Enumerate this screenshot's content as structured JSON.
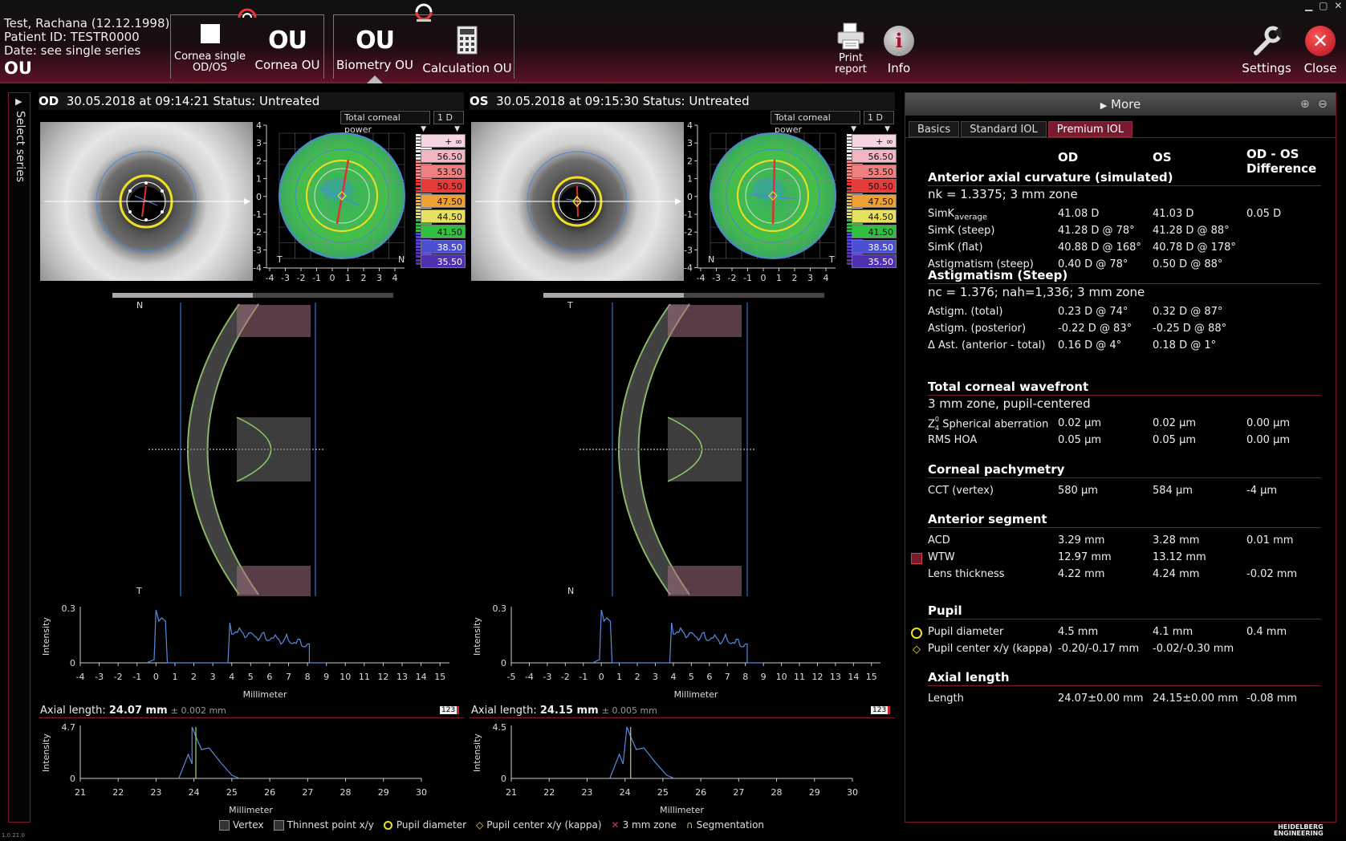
{
  "header": {
    "patient_name": "Test, Rachana (12.12.1998)",
    "patient_id": "Patient ID: TESTR0000",
    "date": "Date: see single series",
    "eye": "OU",
    "buttons": {
      "cornea_single": "Cornea single\nOD/OS",
      "cornea_ou_icon": "OU",
      "cornea_ou": "Cornea OU",
      "biometry_ou_icon": "OU",
      "biometry_ou": "Biometry OU",
      "calculation_ou": "Calculation OU",
      "print": "Print\nreport",
      "info": "Info",
      "settings": "Settings",
      "close": "Close"
    }
  },
  "select_series": "Select series",
  "od": {
    "eye": "OD",
    "title": "30.05.2018 at 09:14:21  Status: Untreated",
    "dropdown_power": "Total corneal power",
    "dropdown_step": "1 D",
    "axial_label": "Axial length:",
    "axial_value": "24.07 mm",
    "axial_sd": "± 0.002 mm",
    "scheimpflug_top": "N",
    "scheimpflug_bottom": "T",
    "map_left": "T",
    "map_right": "N",
    "curve_ymax": "0.3",
    "axial_ymax": "4.7"
  },
  "os": {
    "eye": "OS",
    "title": "30.05.2018 at 09:15:30  Status: Untreated",
    "dropdown_power": "Total corneal power",
    "dropdown_step": "1 D",
    "axial_label": "Axial length:",
    "axial_value": "24.15 mm",
    "axial_sd": "± 0.005 mm",
    "scheimpflug_top": "T",
    "scheimpflug_bottom": "N",
    "map_left": "N",
    "map_right": "T",
    "curve_ymax": "0.3",
    "axial_ymax": "4.5"
  },
  "color_scale": {
    "labels": [
      "+ ∞",
      "56.50",
      "53.50",
      "50.50",
      "47.50",
      "44.50",
      "41.50",
      "38.50",
      "35.50"
    ],
    "colors": [
      "#f5d5e0",
      "#f4b5c2",
      "#f08080",
      "#e53b3b",
      "#f0a030",
      "#e8e060",
      "#30c040",
      "#4a50d0",
      "#5030b0"
    ]
  },
  "axes": {
    "map_ticks": [
      "4",
      "3",
      "2",
      "1",
      "0",
      "-1",
      "-2",
      "-3",
      "-4"
    ],
    "map_xticks": [
      "-4",
      "-3",
      "-2",
      "-1",
      "0",
      "1",
      "2",
      "3",
      "4"
    ],
    "curve_ylabel": "Intensity",
    "curve_xlabel": "Millimeter",
    "curve_ymin": "0",
    "od_curve_x": [
      "-4",
      "-3",
      "-2",
      "-1",
      "0",
      "1",
      "2",
      "3",
      "4",
      "5",
      "6",
      "7",
      "8",
      "9",
      "10",
      "11",
      "12",
      "13",
      "14",
      "15"
    ],
    "os_curve_x": [
      "-5",
      "-4",
      "-3",
      "-2",
      "-1",
      "0",
      "1",
      "2",
      "3",
      "4",
      "5",
      "6",
      "7",
      "8",
      "9",
      "10",
      "11",
      "12",
      "13",
      "14",
      "15"
    ],
    "axial_x": [
      "21",
      "22",
      "23",
      "24",
      "25",
      "26",
      "27",
      "28",
      "29",
      "30"
    ],
    "badge": "123"
  },
  "legend": {
    "vertex": "Vertex",
    "thinnest": "Thinnest point x/y",
    "pupil_diameter": "Pupil diameter",
    "pupil_center": "Pupil center x/y (kappa)",
    "zone": "3 mm zone",
    "segmentation": "Segmentation"
  },
  "right_panel": {
    "more": "More",
    "tabs": [
      "Basics",
      "Standard IOL",
      "Premium IOL"
    ],
    "col_od": "OD",
    "col_os": "OS",
    "col_diff": "OD - OS\nDifference",
    "sections": [
      {
        "title": "Anterior axial curvature (simulated)",
        "sub": "nk = 1.3375; 3 mm zone",
        "rows": [
          [
            "SimK",
            "average",
            "41.08 D",
            "41.03 D",
            "0.05 D"
          ],
          [
            "SimK (steep)",
            "",
            "41.28 D @ 78°",
            "41.28 D @ 88°",
            ""
          ],
          [
            "SimK (flat)",
            "",
            "40.88 D @ 168°",
            "40.78 D @ 178°",
            ""
          ],
          [
            "Astigmatism (steep)",
            "",
            "0.40 D @ 78°",
            "0.50 D @ 88°",
            ""
          ]
        ]
      },
      {
        "title": "Astigmatism (Steep)",
        "sub": "nc = 1.376; nah=1,336; 3 mm zone",
        "rows": [
          [
            "Astigm. (total)",
            "",
            "0.23 D @ 74°",
            "0.32 D @ 87°",
            ""
          ],
          [
            "Astigm. (posterior)",
            "",
            "-0.22 D @ 83°",
            "-0.25 D @ 88°",
            ""
          ],
          [
            "Δ Ast. (anterior - total)",
            "",
            "0.16 D @ 4°",
            "0.18 D @ 1°",
            ""
          ]
        ]
      },
      {
        "title": "Total corneal wavefront",
        "sub": "3 mm zone, pupil-centered",
        "rows": [
          [
            "Z",
            "Spherical aberration",
            "0.02 µm",
            "0.02 µm",
            "0.00 µm"
          ],
          [
            "RMS HOA",
            "",
            "0.05 µm",
            "0.05 µm",
            "0.00 µm"
          ]
        ]
      },
      {
        "title": "Corneal pachymetry",
        "sub": "",
        "rows": [
          [
            "CCT (vertex)",
            "",
            "580 µm",
            "584 µm",
            "-4 µm"
          ]
        ]
      },
      {
        "title": "Anterior segment",
        "sub": "",
        "rows": [
          [
            "ACD",
            "",
            "3.29 mm",
            "3.28 mm",
            "0.01 mm"
          ],
          [
            "WTW",
            "",
            "12.97 mm",
            "13.12 mm",
            ""
          ],
          [
            "Lens thickness",
            "",
            "4.22 mm",
            "4.24 mm",
            "-0.02 mm"
          ]
        ]
      },
      {
        "title": "Pupil",
        "sub": "",
        "rows": [
          [
            "Pupil diameter",
            "",
            "4.5 mm",
            "4.1 mm",
            "0.4 mm"
          ],
          [
            "Pupil center x/y (kappa)",
            "",
            "-0.20/-0.17 mm",
            "-0.02/-0.30 mm",
            ""
          ]
        ]
      },
      {
        "title": "Axial length",
        "sub": "",
        "rows": [
          [
            "Length",
            "",
            "24.07±0.00 mm",
            "24.15±0.00 mm",
            "-0.08 mm"
          ]
        ]
      }
    ]
  },
  "zernike_super": "0",
  "zernike_sub": "4",
  "version": "1.0.21.0",
  "brand": "HEIDELBERG\nENGINEERING"
}
